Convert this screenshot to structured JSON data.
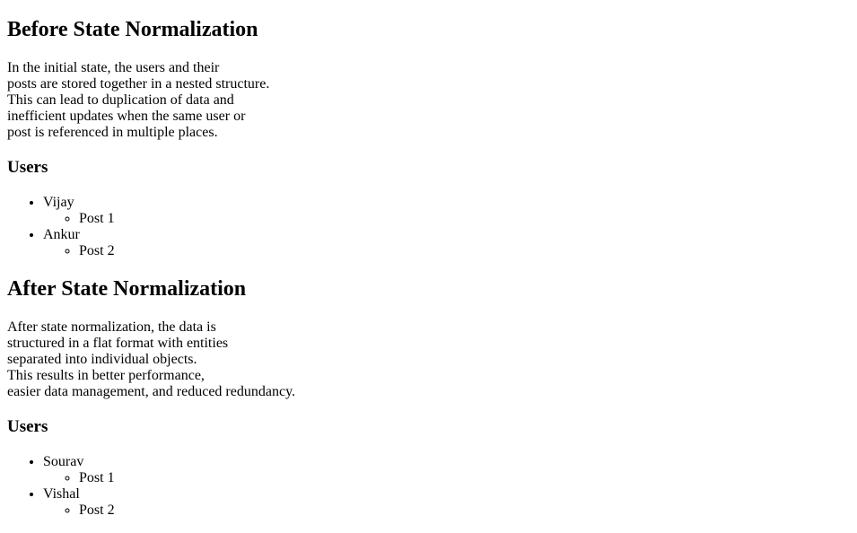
{
  "before": {
    "heading": "Before State Normalization",
    "paragraph_lines": [
      "In the initial state, the users and their",
      "posts are stored together in a nested structure.",
      "This can lead to duplication of data and",
      "inefficient updates when the same user or",
      "post is referenced in multiple places."
    ],
    "users_heading": "Users",
    "users": [
      {
        "name": "Vijay",
        "posts": [
          "Post 1"
        ]
      },
      {
        "name": "Ankur",
        "posts": [
          "Post 2"
        ]
      }
    ]
  },
  "after": {
    "heading": "After State Normalization",
    "paragraph_lines": [
      "After state normalization, the data is",
      "structured in a flat format with entities",
      "separated into individual objects.",
      "This results in better performance,",
      "easier data management, and reduced redundancy."
    ],
    "users_heading": "Users",
    "users": [
      {
        "name": "Sourav",
        "posts": [
          "Post 1"
        ]
      },
      {
        "name": "Vishal",
        "posts": [
          "Post 2"
        ]
      }
    ]
  }
}
